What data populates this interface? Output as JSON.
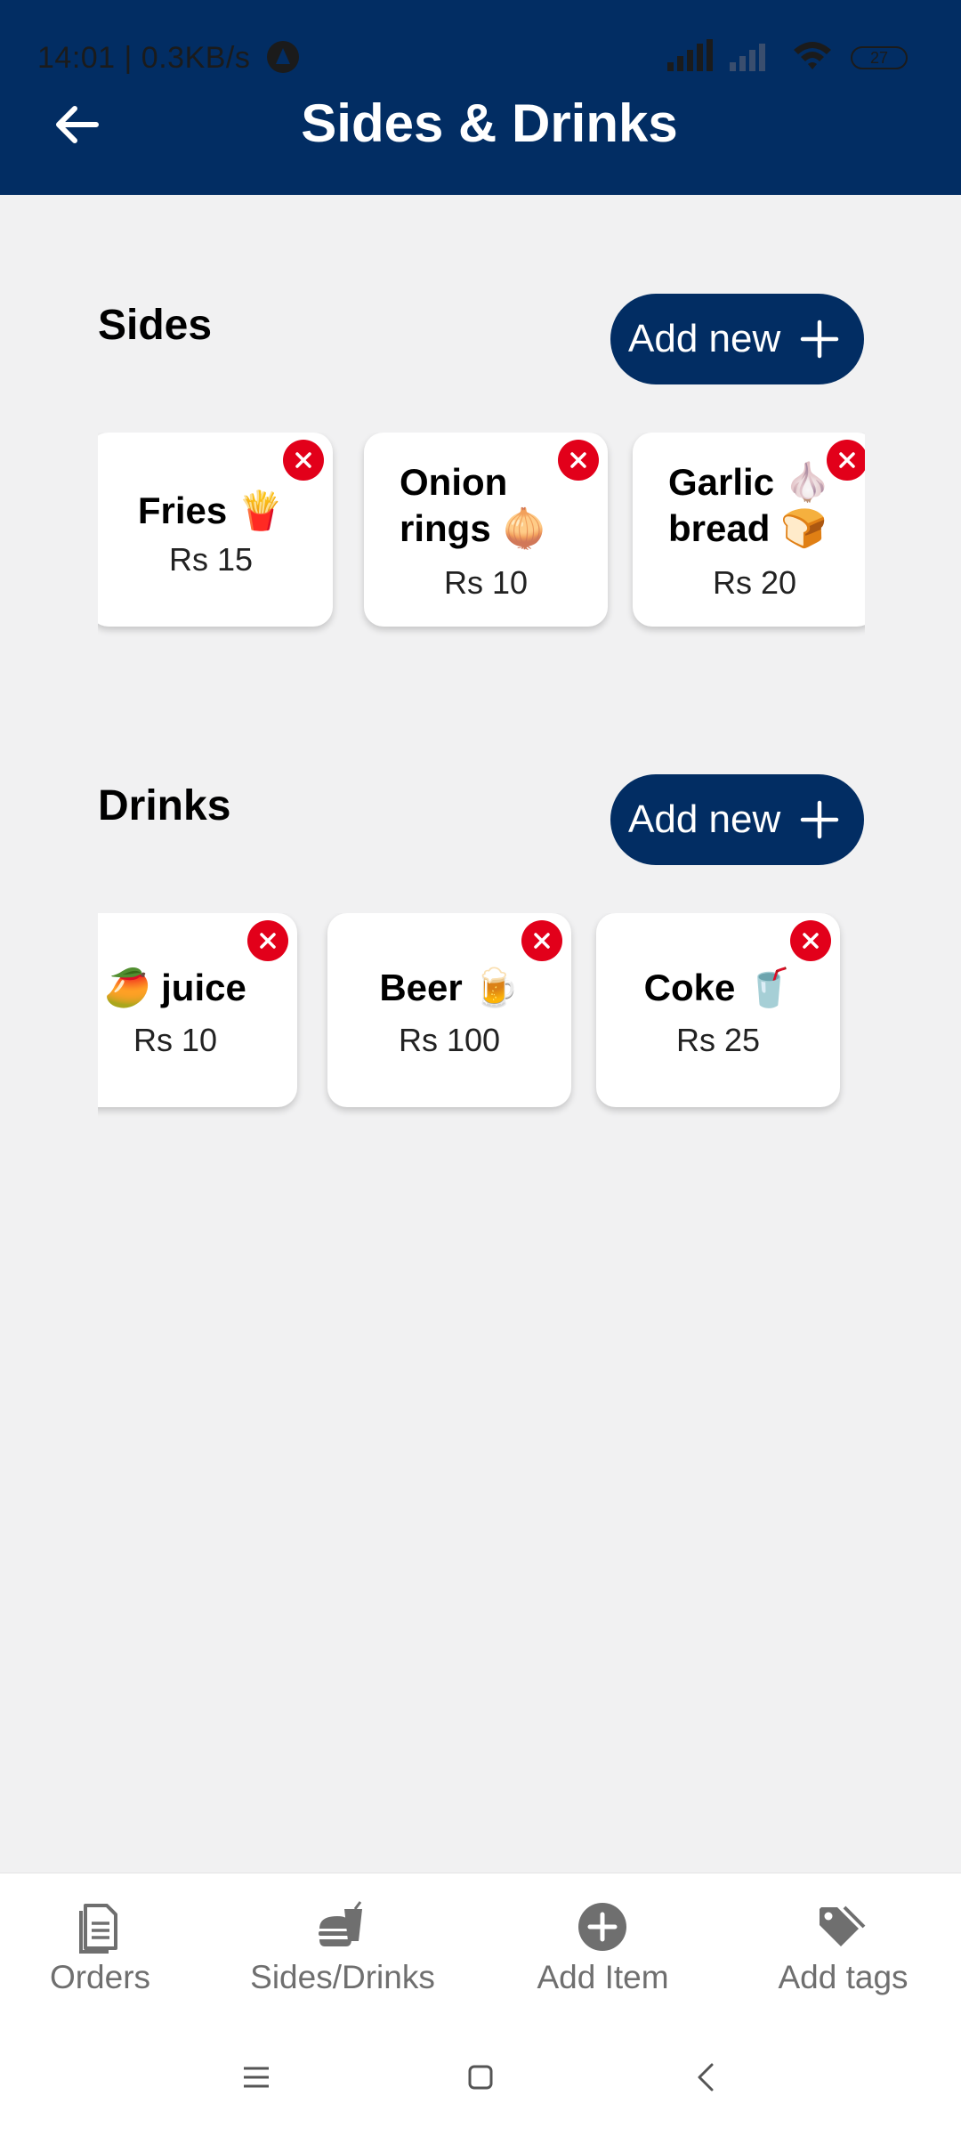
{
  "status_bar": {
    "time_speed": "14:01 | 0.3KB/s",
    "battery": "27"
  },
  "header": {
    "title": "Sides & Drinks"
  },
  "sides": {
    "title": "Sides",
    "add_label": "Add new",
    "items": [
      {
        "name": "Fries 🍟",
        "price": "Rs 15"
      },
      {
        "name": "Onion rings 🧅",
        "price": "Rs 10"
      },
      {
        "name": "Garlic 🧄 bread 🍞",
        "price": "Rs 20"
      }
    ]
  },
  "drinks": {
    "title": "Drinks",
    "add_label": "Add new",
    "items": [
      {
        "name": "🥭 juice",
        "price": "Rs 10"
      },
      {
        "name": "Beer 🍺",
        "price": "Rs 100"
      },
      {
        "name": "Coke 🥤",
        "price": "Rs 25"
      }
    ]
  },
  "bottom_nav": {
    "items": [
      {
        "label": "Orders",
        "icon": "document-icon"
      },
      {
        "label": "Sides/Drinks",
        "icon": "burger-drink-icon"
      },
      {
        "label": "Add Item",
        "icon": "add-circle-icon"
      },
      {
        "label": "Add tags",
        "icon": "tag-icon"
      }
    ]
  },
  "colors": {
    "primary": "#022d63",
    "danger": "#e2001a",
    "background": "#f1f1f2"
  }
}
